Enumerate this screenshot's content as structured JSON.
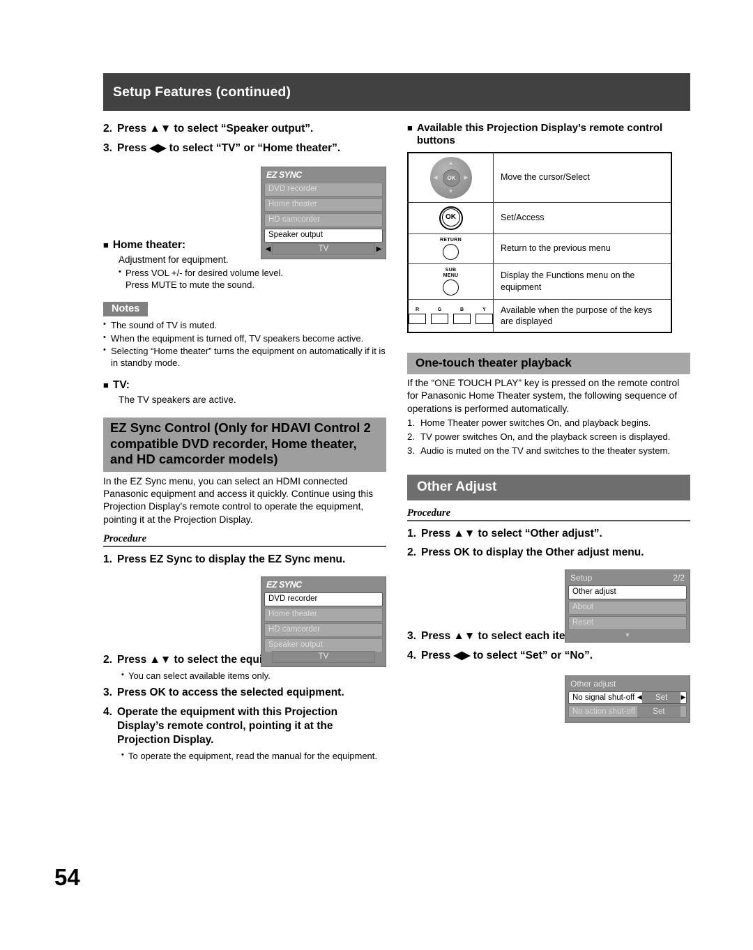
{
  "page": {
    "header_title": "Setup Features (continued)",
    "page_number": "54",
    "colors": {
      "header_bar": "#414141",
      "band_grey": "#9e9e9e",
      "band_dark": "#6e6e6e",
      "notes_tag": "#808080"
    }
  },
  "left_column": {
    "steps_top": [
      {
        "num": "2.",
        "text": "Press ▲▼ to select “Speaker output”."
      },
      {
        "num": "3.",
        "text": "Press ◀▶ to select “TV” or “Home theater”."
      }
    ],
    "ezsync_menu_1": {
      "logo": "EZ SYNC",
      "rows": [
        {
          "label": "DVD recorder",
          "selected": false
        },
        {
          "label": "Home theater",
          "selected": false
        },
        {
          "label": "HD camcorder",
          "selected": false
        }
      ],
      "selected_item": "Speaker output",
      "value": "TV",
      "left_arrow": "◀",
      "right_arrow": "▶"
    },
    "home_theater": {
      "heading": "Home theater:",
      "line": "Adjustment for equipment.",
      "bullets": [
        "Press VOL +/- for desired volume level.",
        "Press MUTE to mute the sound."
      ]
    },
    "notes": {
      "label": "Notes",
      "items": [
        "The sound of TV is muted.",
        "When the equipment is turned off, TV speakers become active.",
        "Selecting “Home theater” turns the equipment on automatically if it is in standby mode."
      ]
    },
    "tv": {
      "heading": "TV:",
      "line": "The TV speakers are active."
    },
    "ez_sync_control": {
      "heading": "EZ Sync Control (Only for HDAVI Control 2 compatible DVD recorder, Home theater, and HD camcorder models)",
      "paragraph": "In the EZ Sync menu, you can select an HDMI connected Panasonic equipment and access it quickly. Continue using this Projection Display’s remote control to operate the equipment, pointing it at the Projection Display.",
      "procedure_label": "Procedure",
      "step1": {
        "num": "1.",
        "text": "Press EZ Sync to display the EZ Sync menu."
      },
      "menu": {
        "logo": "EZ SYNC",
        "selected_item": "DVD recorder",
        "rows": [
          {
            "label": "Home theater"
          },
          {
            "label": "HD camcorder"
          },
          {
            "label": "Speaker output"
          }
        ],
        "value": "TV"
      },
      "step2": {
        "num": "2.",
        "text": "Press ▲▼ to select the equipment."
      },
      "step2_note": "You can select available items only.",
      "step3": {
        "num": "3.",
        "text": "Press OK to access the selected equipment."
      },
      "step4": {
        "num": "4.",
        "text": "Operate the equipment with this Projection Display’s remote control, pointing it at the Projection Display."
      },
      "step4_note": "To operate the equipment, read the manual for the equipment."
    }
  },
  "right_column": {
    "remote_buttons": {
      "heading": "Available this Projection Display’s remote control buttons",
      "rows": [
        {
          "icon": "dpad-icon",
          "label": "OK",
          "description": "Move the cursor/Select"
        },
        {
          "icon": "ok-button-icon",
          "label": "OK",
          "description": "Set/Access"
        },
        {
          "icon": "return-button-icon",
          "label": "RETURN",
          "description": "Return to the previous menu"
        },
        {
          "icon": "sub-menu-button-icon",
          "label": "SUB MENU",
          "description": "Display the Functions menu on the equipment"
        },
        {
          "icon": "color-keys-icon",
          "label": "R G B Y",
          "description": "Available when the purpose of the keys are displayed"
        }
      ],
      "color_key_labels": [
        "R",
        "G",
        "B",
        "Y"
      ],
      "sub_menu_line1": "SUB",
      "sub_menu_line2": "MENU",
      "return_label": "RETURN"
    },
    "one_touch": {
      "heading": "One-touch theater playback",
      "paragraph": "If the “ONE TOUCH PLAY” key is pressed on the remote control for Panasonic Home Theater system, the following sequence of operations is performed automatically.",
      "steps": [
        {
          "num": "1.",
          "text": "Home Theater power switches On, and playback begins."
        },
        {
          "num": "2.",
          "text": "TV power switches On, and the playback screen is displayed."
        },
        {
          "num": "3.",
          "text": "Audio is muted on the TV and switches to the theater system."
        }
      ]
    },
    "other_adjust": {
      "heading": "Other Adjust",
      "procedure_label": "Procedure",
      "step1": {
        "num": "1.",
        "text": "Press ▲▼ to select “Other adjust”."
      },
      "step2": {
        "num": "2.",
        "text": "Press OK to display the Other adjust menu."
      },
      "setup_menu": {
        "title": "Setup",
        "page_indicator": "2/2",
        "selected_item": "Other adjust",
        "rows": [
          {
            "label": "About"
          },
          {
            "label": "Reset"
          }
        ],
        "scroll_arrow": "▼"
      },
      "step3": {
        "num": "3.",
        "text": "Press ▲▼ to select each item."
      },
      "step4": {
        "num": "4.",
        "text": "Press ◀▶ to select “Set” or “No”."
      },
      "other_adjust_menu": {
        "title": "Other adjust",
        "selected_row": {
          "label": "No signal shut-off",
          "value": "Set",
          "left_arrow": "◀",
          "right_arrow": "▶"
        },
        "dim_row": {
          "label": "No action shut-off",
          "value": "Set"
        }
      }
    }
  }
}
